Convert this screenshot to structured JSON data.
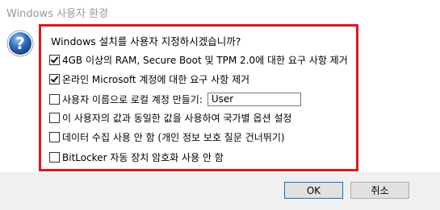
{
  "window": {
    "title": "Windows 사용자 환경"
  },
  "dialog": {
    "prompt": "Windows 설치를 사용자 지정하시겠습니까?",
    "options": [
      {
        "label": "4GB 이상의 RAM, Secure Boot 및 TPM 2.0에 대한 요구 사항 제거",
        "checked": true
      },
      {
        "label": "온라인 Microsoft 계정에 대한 요구 사항 제거",
        "checked": true
      },
      {
        "label": "사용자 이름으로 로컬 계정 만들기:",
        "checked": false
      },
      {
        "label": "이 사용자의 값과 동일한 값을 사용하여 국가별 옵션 설정",
        "checked": false
      },
      {
        "label": "데이터 수집 사용 안 함 (개인 정보 보호 질문 건너뛰기)",
        "checked": false
      },
      {
        "label": "BitLocker 자동 장치 암호화 사용 안 함",
        "checked": false
      }
    ],
    "username_value": "User"
  },
  "buttons": {
    "ok_label": "OK",
    "cancel_label": "취소"
  },
  "icons": {
    "dialog_icon": "question-icon"
  },
  "colors": {
    "highlight_border": "#e0161d",
    "icon_blue": "#1f5aa6"
  }
}
